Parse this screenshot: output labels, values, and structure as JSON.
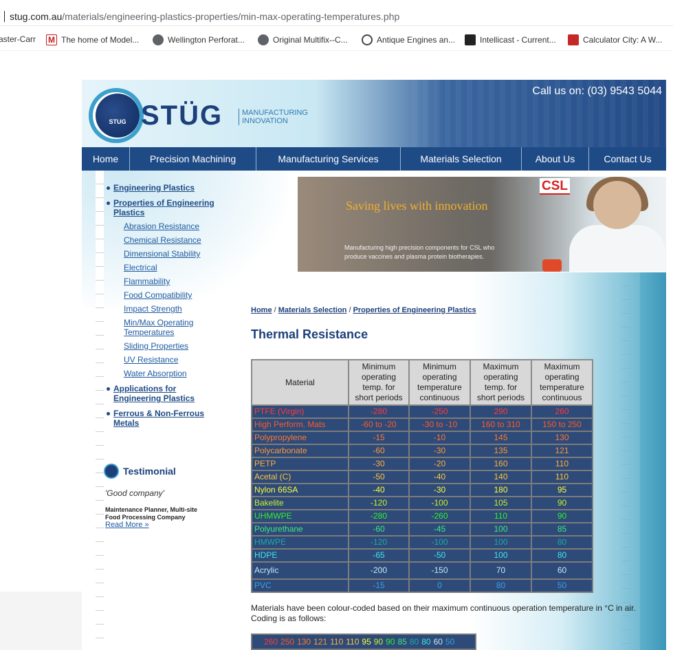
{
  "browser": {
    "url_host": "stug.com.au",
    "url_path": "/materials/engineering-plastics-properties/min-max-operating-temperatures.php",
    "bookmarks": [
      {
        "label": "aster-Carr",
        "icon": "none"
      },
      {
        "label": "The home of Model...",
        "icon": "m-logo-icon"
      },
      {
        "label": "Wellington Perforat...",
        "icon": "globe-icon"
      },
      {
        "label": "Original Multifix--C...",
        "icon": "globe-icon"
      },
      {
        "label": "Antique Engines an...",
        "icon": "wheel-icon"
      },
      {
        "label": "Intellicast - Current...",
        "icon": "weather-icon"
      },
      {
        "label": "Calculator City: A W...",
        "icon": "calculator-icon"
      }
    ]
  },
  "header": {
    "logo_small": "STUG",
    "logo_word": "STÜG",
    "tagline_1": "MANUFACTURING",
    "tagline_2": "INNOVATION",
    "call": "Call us on: (03) 9543 5044"
  },
  "nav": [
    "Home",
    "Precision Machining",
    "Manufacturing Services",
    "Materials Selection",
    "About Us",
    "Contact Us"
  ],
  "sidebar": {
    "engineering_plastics": "Engineering Plastics",
    "properties_1": "Properties of Engineering",
    "properties_2": "Plastics",
    "sub_items": [
      "Abrasion Resistance",
      "Chemical Resistance",
      "Dimensional Stability",
      "Electrical",
      "Flammability",
      "Food Compatibility",
      "Impact Strength",
      "Min/Max Operating",
      "Temperatures",
      "Sliding Properties",
      "UV Resistance",
      "Water Absorption"
    ],
    "applications_1": "Applications for",
    "applications_2": "Engineering Plastics",
    "metals_1": "Ferrous & Non-Ferrous",
    "metals_2": "Metals"
  },
  "testimonial": {
    "title": "Testimonial",
    "quote": "'Good company'",
    "name_1": "Maintenance Planner, Multi-site",
    "name_2": "Food Processing Company",
    "read_more": "Read More »"
  },
  "banner": {
    "headline": "Saving lives with innovation",
    "sub_1": "Manufacturing high precision components for CSL who",
    "sub_2": "produce vaccines and plasma protein biotherapies.",
    "brand": "CSL"
  },
  "breadcrumb": {
    "home": "Home",
    "sep": " / ",
    "materials": "Materials Selection",
    "properties": "Properties of Engineering Plastics"
  },
  "page_title": "Thermal Resistance",
  "table": {
    "headers": [
      [
        "Material"
      ],
      [
        "Minimum",
        "operating",
        "temp. for",
        "short periods"
      ],
      [
        "Minimum",
        "operating",
        "temperature",
        "continuous"
      ],
      [
        "Maximum",
        "operating",
        "temp. for",
        "short periods"
      ],
      [
        "Maximum",
        "operating",
        "temperature",
        "continuous"
      ]
    ],
    "rows": [
      {
        "material": "PTFE (Virgin)",
        "min_short": "-280",
        "min_cont": "-250",
        "max_short": "290",
        "max_cont": "260",
        "color": "#ff3b3b"
      },
      {
        "material": "High Perform. Mats",
        "min_short": "-60 to -20",
        "min_cont": "-30 to -10",
        "max_short": "160 to 310",
        "max_cont": "150 to 250",
        "color": "#ff5a2a"
      },
      {
        "material": "Polypropylene",
        "min_short": "-15",
        "min_cont": "-10",
        "max_short": "145",
        "max_cont": "130",
        "color": "#ff7a30"
      },
      {
        "material": "Polycarbonate",
        "min_short": "-60",
        "min_cont": "-30",
        "max_short": "135",
        "max_cont": "121",
        "color": "#ff9838"
      },
      {
        "material": "PETP",
        "min_short": "-30",
        "min_cont": "-20",
        "max_short": "160",
        "max_cont": "110",
        "color": "#ffb040"
      },
      {
        "material": "Acetal (C)",
        "min_short": "-50",
        "min_cont": "-40",
        "max_short": "140",
        "max_cont": "110",
        "color": "#ffc640"
      },
      {
        "material": "Nylon 66SA",
        "min_short": "-40",
        "min_cont": "-30",
        "max_short": "180",
        "max_cont": "95",
        "color": "#ffff3a"
      },
      {
        "material": "Bakelite",
        "min_short": "-120",
        "min_cont": "-100",
        "max_short": "105",
        "max_cont": "90",
        "color": "#c8f030"
      },
      {
        "material": "UHMWPE",
        "min_short": "-280",
        "min_cont": "-260",
        "max_short": "110",
        "max_cont": "90",
        "color": "#30f030"
      },
      {
        "material": "Polyurethane",
        "min_short": "-60",
        "min_cont": "-45",
        "max_short": "100",
        "max_cont": "85",
        "color": "#40e880"
      },
      {
        "material": "HMWPE",
        "min_short": "-120",
        "min_cont": "-100",
        "max_short": "100",
        "max_cont": "80",
        "color": "#20a8a8"
      },
      {
        "material": "HDPE",
        "min_short": "-65",
        "min_cont": "-50",
        "max_short": "100",
        "max_cont": "80",
        "color": "#40e8e8"
      },
      {
        "material": "Acrylic",
        "min_short": "-200",
        "min_cont": "-150",
        "max_short": "70",
        "max_cont": "60",
        "color": "#c8e8f8"
      },
      {
        "material": "PVC",
        "min_short": "-15",
        "min_cont": "0",
        "max_short": "80",
        "max_cont": "50",
        "color": "#3aa0e8"
      }
    ]
  },
  "note": "Materials have been colour-coded based on their maximum continuous operation temperature in °C in air. Coding is as follows:",
  "legend": [
    {
      "value": "260",
      "color": "#ff3b3b"
    },
    {
      "value": "250",
      "color": "#ff5a2a"
    },
    {
      "value": "130",
      "color": "#ff7a30"
    },
    {
      "value": "121",
      "color": "#ff9838"
    },
    {
      "value": "110",
      "color": "#ffb040"
    },
    {
      "value": "110",
      "color": "#ffc640"
    },
    {
      "value": "95",
      "color": "#ffff3a"
    },
    {
      "value": "90",
      "color": "#c8f030"
    },
    {
      "value": "90",
      "color": "#30f030"
    },
    {
      "value": "85",
      "color": "#40e880"
    },
    {
      "value": "80",
      "color": "#20a8a8"
    },
    {
      "value": "80",
      "color": "#40e8e8"
    },
    {
      "value": "60",
      "color": "#c8e8f8"
    },
    {
      "value": "50",
      "color": "#3aa0e8"
    }
  ]
}
